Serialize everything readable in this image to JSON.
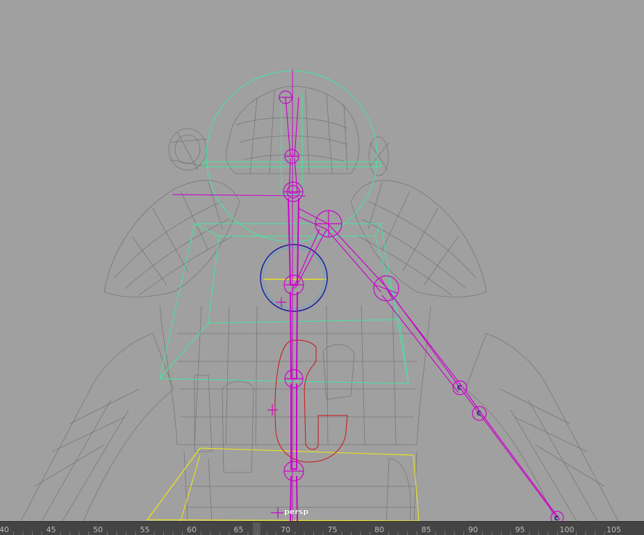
{
  "viewport": {
    "camera_label": "persp",
    "background_color": "#a0a0a0",
    "mesh_color": "#6e6e6e",
    "joint_color": "#cc00cc",
    "control_curve_color": "#40e8a0",
    "pelvis_curve_color": "#e8e020",
    "spine_curve_color": "#d01010",
    "chest_ring_color": "#1a1aa0"
  },
  "timeline": {
    "ticks": [
      "40",
      "45",
      "50",
      "55",
      "60",
      "65",
      "70",
      "75",
      "80",
      "85",
      "90",
      "95",
      "100",
      "105"
    ],
    "current_frame_marker": "playhead"
  }
}
